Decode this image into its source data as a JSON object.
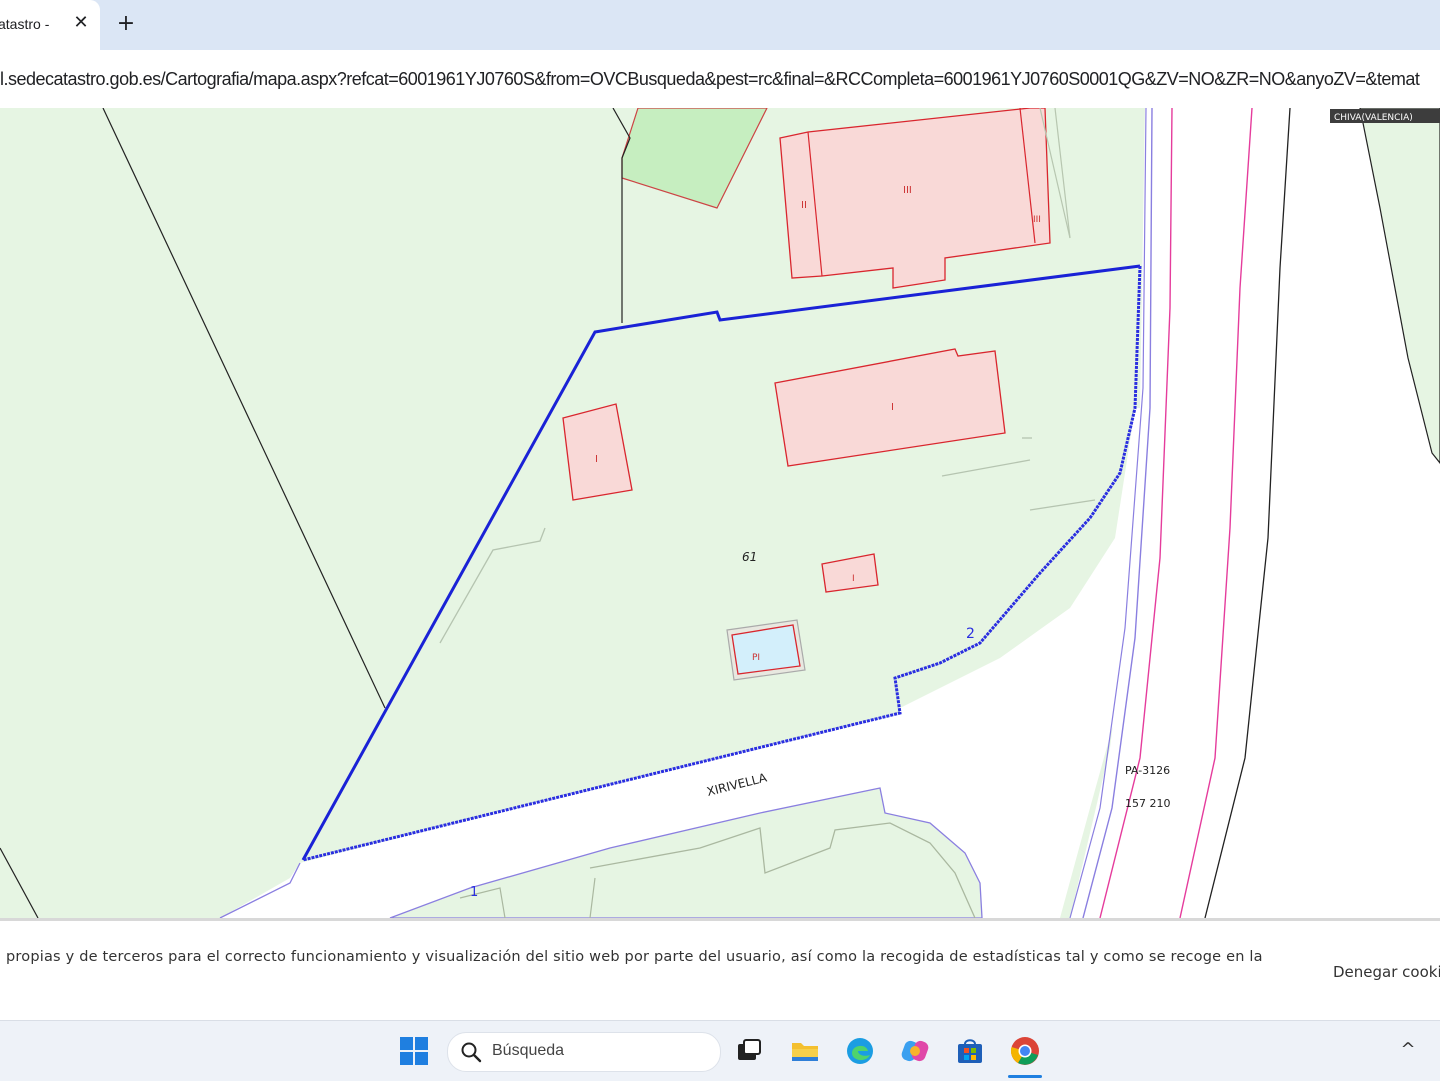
{
  "browser": {
    "tab_title": "atastro -",
    "tab_close": "✕",
    "new_tab": "+",
    "url": "l.sedecatastro.gob.es/Cartografia/mapa.aspx?refcat=6001961YJ0760S&from=OVCBusqueda&pest=rc&final=&RCCompleta=6001961YJ0760S0001QG&ZV=NO&ZR=NO&anyoZV=&temat"
  },
  "map": {
    "municipality_badge": "CHIVA(VALENCIA)",
    "parcel_number": "61",
    "street_name": "XIRIVELLA",
    "road_label": "PA-3126",
    "road_km": "157 210",
    "boundary_marker_1": "1",
    "boundary_marker_2": "2",
    "building_labels": {
      "top_small": "II",
      "top_main": "III",
      "top_edge": "III",
      "left_block": "I",
      "right_block": "I",
      "small_block": "I",
      "pool": "PI"
    },
    "colors": {
      "parcel_fill": "#e6f5e3",
      "dark_green_fill": "#c6eec0",
      "building_fill": "#f9d9d7",
      "building_stroke": "#d9262e",
      "parcel_border": "#2a2ee0",
      "road_line": "#e53c9c",
      "pool_fill": "#d3effb"
    }
  },
  "cookie_banner": {
    "text": "propias y de terceros para el correcto funcionamiento y visualización del sitio web por parte del usuario, así como la recogida de estadísticas tal y como se recoge en la",
    "deny_button": "Denegar cooki"
  },
  "taskbar": {
    "search_placeholder": "Búsqueda",
    "tray_chevron": "^"
  }
}
